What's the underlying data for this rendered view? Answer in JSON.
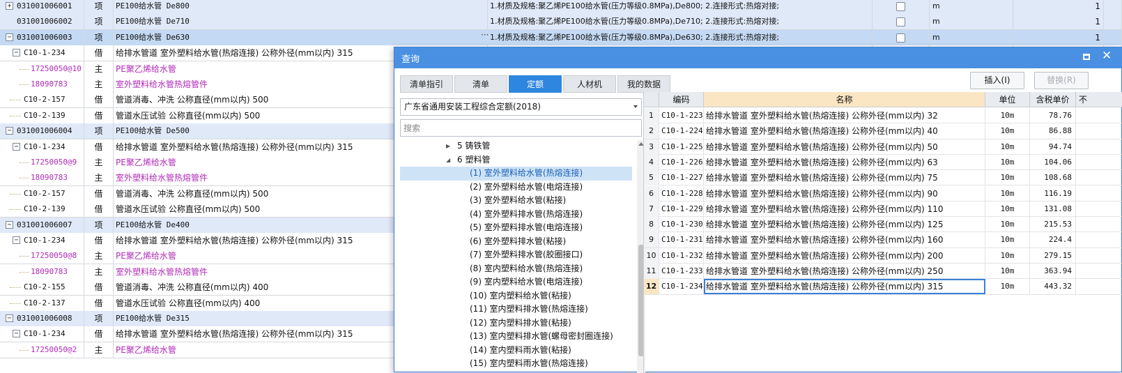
{
  "bill_rows": [
    {
      "code": "031001006001",
      "type": "项",
      "name": "PE100给水管 De800",
      "features": "1.材质及规格:聚乙烯PE100给水管(压力等级0.8MPa),De800; 2.连接形式:热熔对接;",
      "unit": "m",
      "qty": "1",
      "kind": "qd",
      "expand": "+"
    },
    {
      "code": "031001006002",
      "type": "项",
      "name": "PE100给水管 De710",
      "features": "1.材质及规格:聚乙烯PE100给水管(压力等级0.8MPa),De710; 2.连接形式:热熔对接;",
      "unit": "m",
      "qty": "1",
      "kind": "qd",
      "expand": ""
    },
    {
      "code": "031001006003",
      "type": "项",
      "name": "PE100给水管 De630",
      "features": "1.材质及规格:聚乙烯PE100给水管(压力等级0.8MPa),De630; 2.连接形式:热熔对接;",
      "unit": "m",
      "qty": "1",
      "kind": "sel",
      "expand": "−",
      "more": "···"
    },
    {
      "code": "C10-1-234",
      "type": "借",
      "name": "给排水管道 室外塑料给水管(热熔连接) 公称外径(mm以内) 315",
      "kind": "de",
      "expand": "−"
    },
    {
      "code": "17250050@10",
      "type": "主",
      "name": "PE聚乙烯给水管",
      "kind": "mat"
    },
    {
      "code": "18090783",
      "type": "主",
      "name": "室外塑料给水管热熔管件",
      "kind": "mat"
    },
    {
      "code": "C10-2-157",
      "type": "借",
      "name": "管道消毒、冲洗 公称直径(mm以内) 500",
      "kind": "de"
    },
    {
      "code": "C10-2-139",
      "type": "借",
      "name": "管道水压试验 公称直径(mm以内) 500",
      "kind": "de"
    },
    {
      "code": "031001006004",
      "type": "项",
      "name": "PE100给水管 De500",
      "kind": "qd",
      "expand": "−"
    },
    {
      "code": "C10-1-234",
      "type": "借",
      "name": "给排水管道 室外塑料给水管(热熔连接) 公称外径(mm以内) 315",
      "kind": "de",
      "expand": "−"
    },
    {
      "code": "17250050@9",
      "type": "主",
      "name": "PE聚乙烯给水管",
      "kind": "mat"
    },
    {
      "code": "18090783",
      "type": "主",
      "name": "室外塑料给水管热熔管件",
      "kind": "mat"
    },
    {
      "code": "C10-2-157",
      "type": "借",
      "name": "管道消毒、冲洗 公称直径(mm以内) 500",
      "kind": "de"
    },
    {
      "code": "C10-2-139",
      "type": "借",
      "name": "管道水压试验 公称直径(mm以内) 500",
      "kind": "de"
    },
    {
      "code": "031001006007",
      "type": "项",
      "name": "PE100给水管 De400",
      "kind": "qd",
      "expand": "−"
    },
    {
      "code": "C10-1-234",
      "type": "借",
      "name": "给排水管道 室外塑料给水管(热熔连接) 公称外径(mm以内) 315",
      "kind": "de",
      "expand": "−"
    },
    {
      "code": "17250050@8",
      "type": "主",
      "name": "PE聚乙烯给水管",
      "kind": "mat"
    },
    {
      "code": "18090783",
      "type": "主",
      "name": "室外塑料给水管热熔管件",
      "kind": "mat"
    },
    {
      "code": "C10-2-155",
      "type": "借",
      "name": "管道消毒、冲洗 公称直径(mm以内) 400",
      "kind": "de"
    },
    {
      "code": "C10-2-137",
      "type": "借",
      "name": "管道水压试验 公称直径(mm以内) 400",
      "kind": "de"
    },
    {
      "code": "031001006008",
      "type": "项",
      "name": "PE100给水管 De315",
      "kind": "qd",
      "expand": "−"
    },
    {
      "code": "C10-1-234",
      "type": "借",
      "name": "给排水管道 室外塑料给水管(热熔连接) 公称外径(mm以内) 315",
      "kind": "de",
      "expand": "−"
    },
    {
      "code": "17250050@2",
      "type": "主",
      "name": "PE聚乙烯给水管",
      "kind": "mat"
    }
  ],
  "dialog": {
    "title": "查询",
    "tabs": [
      "清单指引",
      "清单",
      "定额",
      "人材机",
      "我的数据"
    ],
    "active_tab": "定额",
    "insert_label": "插入(I)",
    "replace_label": "替换(R)",
    "quota_library": "广东省通用安装工程综合定额(2018)",
    "search_placeholder": "搜索",
    "tree": [
      {
        "label": "5 铸铁管",
        "level": 0,
        "arrow": "right"
      },
      {
        "label": "6 塑料管",
        "level": 0,
        "arrow": "down"
      },
      {
        "label": "(1) 室外塑料给水管(热熔连接)",
        "level": 1,
        "selected": true
      },
      {
        "label": "(2) 室外塑料给水管(电熔连接)",
        "level": 1
      },
      {
        "label": "(3) 室外塑料给水管(粘接)",
        "level": 1
      },
      {
        "label": "(4) 室外塑料排水管(热熔连接)",
        "level": 1
      },
      {
        "label": "(5) 室外塑料排水管(电熔连接)",
        "level": 1
      },
      {
        "label": "(6) 室外塑料排水管(粘接)",
        "level": 1
      },
      {
        "label": "(7) 室外塑料排水管(胶圈接口)",
        "level": 1
      },
      {
        "label": "(8) 室内塑料给水管(热熔连接)",
        "level": 1
      },
      {
        "label": "(9) 室内塑料给水管(电熔连接)",
        "level": 1
      },
      {
        "label": "(10) 室内塑料给水管(粘接)",
        "level": 1
      },
      {
        "label": "(11) 室内塑料排水管(热熔连接)",
        "level": 1
      },
      {
        "label": "(12) 室内塑料排水管(粘接)",
        "level": 1
      },
      {
        "label": "(13) 室内塑料排水管(螺母密封圈连接)",
        "level": 1
      },
      {
        "label": "(14) 室内塑料雨水管(粘接)",
        "level": 1
      },
      {
        "label": "(15) 室内塑料雨水管(热熔连接)",
        "level": 1
      }
    ],
    "grid": {
      "headers": [
        "编码",
        "名称",
        "单位",
        "含税单价",
        "不"
      ],
      "rows": [
        {
          "no": "1",
          "code": "C10-1-223",
          "name": "给排水管道 室外塑料给水管(热熔连接) 公称外径(mm以内) 32",
          "unit": "10m",
          "price": "78.76"
        },
        {
          "no": "2",
          "code": "C10-1-224",
          "name": "给排水管道 室外塑料给水管(热熔连接) 公称外径(mm以内) 40",
          "unit": "10m",
          "price": "86.88"
        },
        {
          "no": "3",
          "code": "C10-1-225",
          "name": "给排水管道 室外塑料给水管(热熔连接) 公称外径(mm以内) 50",
          "unit": "10m",
          "price": "94.74"
        },
        {
          "no": "4",
          "code": "C10-1-226",
          "name": "给排水管道 室外塑料给水管(热熔连接) 公称外径(mm以内) 63",
          "unit": "10m",
          "price": "104.06"
        },
        {
          "no": "5",
          "code": "C10-1-227",
          "name": "给排水管道 室外塑料给水管(热熔连接) 公称外径(mm以内) 75",
          "unit": "10m",
          "price": "108.68"
        },
        {
          "no": "6",
          "code": "C10-1-228",
          "name": "给排水管道 室外塑料给水管(热熔连接) 公称外径(mm以内) 90",
          "unit": "10m",
          "price": "116.19"
        },
        {
          "no": "7",
          "code": "C10-1-229",
          "name": "给排水管道 室外塑料给水管(热熔连接) 公称外径(mm以内) 110",
          "unit": "10m",
          "price": "131.08"
        },
        {
          "no": "8",
          "code": "C10-1-230",
          "name": "给排水管道 室外塑料给水管(热熔连接) 公称外径(mm以内) 125",
          "unit": "10m",
          "price": "215.53"
        },
        {
          "no": "9",
          "code": "C10-1-231",
          "name": "给排水管道 室外塑料给水管(热熔连接) 公称外径(mm以内) 160",
          "unit": "10m",
          "price": "224.4"
        },
        {
          "no": "10",
          "code": "C10-1-232",
          "name": "给排水管道 室外塑料给水管(热熔连接) 公称外径(mm以内) 200",
          "unit": "10m",
          "price": "279.15"
        },
        {
          "no": "11",
          "code": "C10-1-233",
          "name": "给排水管道 室外塑料给水管(热熔连接) 公称外径(mm以内) 250",
          "unit": "10m",
          "price": "363.94"
        },
        {
          "no": "12",
          "code": "C10-1-234",
          "name": "给排水管道 室外塑料给水管(热熔连接) 公称外径(mm以内) 315",
          "unit": "10m",
          "price": "443.32",
          "selected": true
        }
      ]
    }
  },
  "colors": {
    "accent": "#4a90e2",
    "tab_active": "#2e86de",
    "material_text": "#b02bb8",
    "bill_row": "#dfe9f8",
    "bill_selected": "#c4d9f3"
  }
}
